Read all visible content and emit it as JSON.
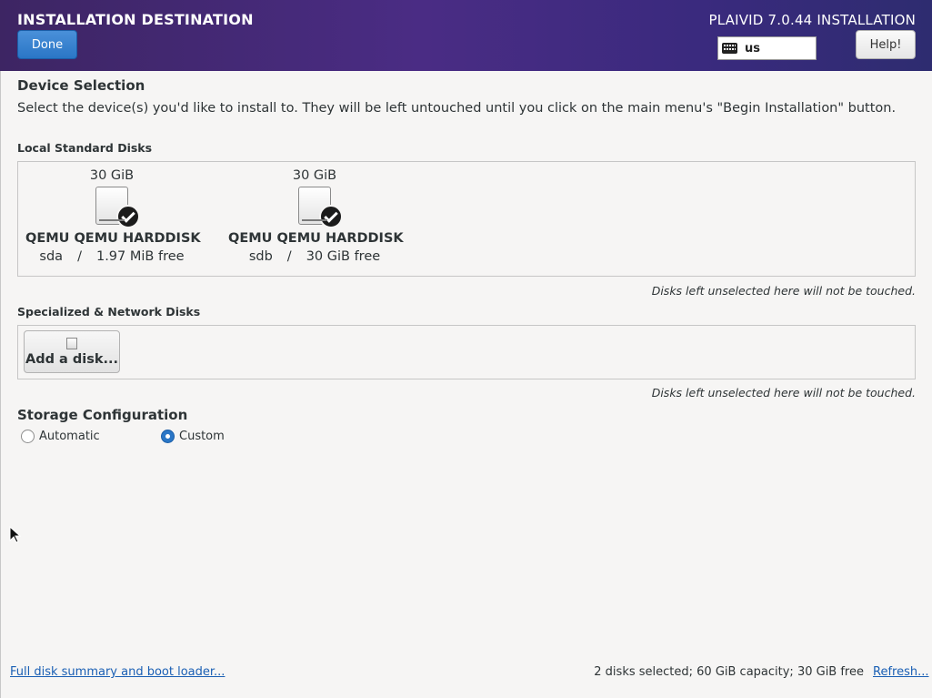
{
  "header": {
    "page_title": "INSTALLATION DESTINATION",
    "done_label": "Done",
    "product_title": "PLAIVID 7.0.44 INSTALLATION",
    "keyboard_layout": "us",
    "help_label": "Help!"
  },
  "device_selection": {
    "title": "Device Selection",
    "intro": "Select the device(s) you'd like to install to.  They will be left untouched until you click on the main menu's \"Begin Installation\" button."
  },
  "local_disks": {
    "title": "Local Standard Disks",
    "disks": [
      {
        "size": "30 GiB",
        "model": "QEMU QEMU HARDDISK",
        "device": "sda",
        "separator": "/",
        "free": "1.97 MiB free",
        "selected": true
      },
      {
        "size": "30 GiB",
        "model": "QEMU QEMU HARDDISK",
        "device": "sdb",
        "separator": "/",
        "free": "30 GiB free",
        "selected": true
      }
    ],
    "hint": "Disks left unselected here will not be touched."
  },
  "network_disks": {
    "title": "Specialized & Network Disks",
    "add_label": "Add a disk...",
    "hint": "Disks left unselected here will not be touched."
  },
  "storage_config": {
    "title": "Storage Configuration",
    "options": [
      {
        "label": "Automatic",
        "selected": false
      },
      {
        "label": "Custom",
        "selected": true
      }
    ]
  },
  "footer": {
    "summary_link": "Full disk summary and boot loader...",
    "status": "2 disks selected; 60 GiB capacity; 30 GiB free",
    "refresh_link": "Refresh..."
  },
  "colors": {
    "accent": "#2a76c6",
    "link": "#1a5fb4",
    "header_start": "#3d2563",
    "header_end": "#2e2c70"
  }
}
